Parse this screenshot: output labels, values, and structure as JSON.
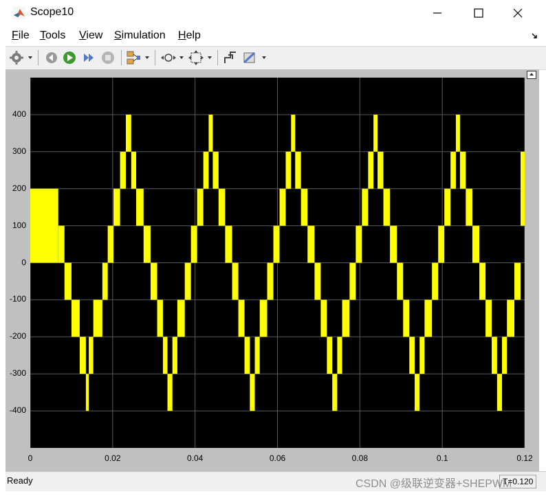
{
  "window": {
    "title": "Scope10"
  },
  "menu": {
    "items": [
      {
        "label": "File",
        "accel": "F",
        "rest": "ile"
      },
      {
        "label": "Tools",
        "accel": "T",
        "rest": "ools"
      },
      {
        "label": "View",
        "accel": "V",
        "rest": "iew"
      },
      {
        "label": "Simulation",
        "accel": "S",
        "rest": "imulation"
      },
      {
        "label": "Help",
        "accel": "H",
        "rest": "elp"
      }
    ]
  },
  "toolbar": {
    "icons": [
      "settings-gear-icon",
      "step-back-icon",
      "run-icon",
      "step-forward-icon",
      "stop-icon",
      "signal-select-icon",
      "zoom-icon",
      "autoscale-icon",
      "restore-layout-icon",
      "cursor-measure-icon"
    ]
  },
  "chart_data": {
    "type": "line",
    "title": "",
    "xlabel": "",
    "ylabel": "",
    "xlim": [
      0,
      0.12
    ],
    "ylim": [
      -500,
      500
    ],
    "xticks": [
      "0",
      "0.02",
      "0.04",
      "0.06",
      "0.08",
      "0.1",
      "0.12"
    ],
    "yticks": [
      "400",
      "300",
      "200",
      "100",
      "0",
      "-100",
      "-200",
      "-300",
      "-400"
    ],
    "grid": true,
    "background": "#000000",
    "series": [
      {
        "color": "#ffff00",
        "description_levels": "multilevel staircase PWM waveform, 9 levels from -400 to 400",
        "blocks": [
          {
            "x0": 0.0,
            "x1": 0.0068,
            "y0": 0,
            "y1": 200
          },
          {
            "x0": 0.0068,
            "x1": 0.0083,
            "y0": 0,
            "y1": 100
          },
          {
            "x0": 0.0083,
            "x1": 0.01,
            "y0": -100,
            "y1": 0
          },
          {
            "x0": 0.01,
            "x1": 0.012,
            "y0": -200,
            "y1": -100
          },
          {
            "x0": 0.012,
            "x1": 0.0135,
            "y0": -300,
            "y1": -200
          },
          {
            "x0": 0.0135,
            "x1": 0.0142,
            "y0": -400,
            "y1": -300
          },
          {
            "x0": 0.0142,
            "x1": 0.0153,
            "y0": -300,
            "y1": -200
          },
          {
            "x0": 0.0153,
            "x1": 0.0175,
            "y0": -200,
            "y1": -100
          },
          {
            "x0": 0.0175,
            "x1": 0.0188,
            "y0": -100,
            "y1": 0
          },
          {
            "x0": 0.0188,
            "x1": 0.0202,
            "y0": 0,
            "y1": 100
          },
          {
            "x0": 0.0202,
            "x1": 0.0218,
            "y0": 100,
            "y1": 200
          },
          {
            "x0": 0.0218,
            "x1": 0.0232,
            "y0": 200,
            "y1": 300
          },
          {
            "x0": 0.0232,
            "x1": 0.0245,
            "y0": 300,
            "y1": 400
          },
          {
            "x0": 0.0245,
            "x1": 0.0257,
            "y0": 200,
            "y1": 300
          },
          {
            "x0": 0.0257,
            "x1": 0.0275,
            "y0": 100,
            "y1": 200
          },
          {
            "x0": 0.0275,
            "x1": 0.0292,
            "y0": 0,
            "y1": 100
          },
          {
            "x0": 0.0292,
            "x1": 0.0308,
            "y0": -100,
            "y1": 0
          },
          {
            "x0": 0.0308,
            "x1": 0.0322,
            "y0": -200,
            "y1": -100
          },
          {
            "x0": 0.0322,
            "x1": 0.0333,
            "y0": -300,
            "y1": -200
          },
          {
            "x0": 0.0333,
            "x1": 0.0345,
            "y0": -400,
            "y1": -300
          },
          {
            "x0": 0.0345,
            "x1": 0.0357,
            "y0": -300,
            "y1": -200
          },
          {
            "x0": 0.0357,
            "x1": 0.0375,
            "y0": -200,
            "y1": -100
          },
          {
            "x0": 0.0375,
            "x1": 0.039,
            "y0": -100,
            "y1": 0
          },
          {
            "x0": 0.039,
            "x1": 0.0405,
            "y0": 0,
            "y1": 100
          },
          {
            "x0": 0.0405,
            "x1": 0.042,
            "y0": 100,
            "y1": 200
          },
          {
            "x0": 0.042,
            "x1": 0.0433,
            "y0": 200,
            "y1": 300
          },
          {
            "x0": 0.0433,
            "x1": 0.0443,
            "y0": 300,
            "y1": 400
          },
          {
            "x0": 0.0443,
            "x1": 0.0457,
            "y0": 200,
            "y1": 300
          },
          {
            "x0": 0.0457,
            "x1": 0.0473,
            "y0": 100,
            "y1": 200
          },
          {
            "x0": 0.0473,
            "x1": 0.049,
            "y0": 0,
            "y1": 100
          },
          {
            "x0": 0.049,
            "x1": 0.0505,
            "y0": -100,
            "y1": 0
          },
          {
            "x0": 0.0505,
            "x1": 0.052,
            "y0": -200,
            "y1": -100
          },
          {
            "x0": 0.052,
            "x1": 0.0533,
            "y0": -300,
            "y1": -200
          },
          {
            "x0": 0.0533,
            "x1": 0.0545,
            "y0": -400,
            "y1": -300
          },
          {
            "x0": 0.0545,
            "x1": 0.0557,
            "y0": -300,
            "y1": -200
          },
          {
            "x0": 0.0557,
            "x1": 0.0575,
            "y0": -200,
            "y1": -100
          },
          {
            "x0": 0.0575,
            "x1": 0.059,
            "y0": -100,
            "y1": 0
          },
          {
            "x0": 0.059,
            "x1": 0.0605,
            "y0": 0,
            "y1": 100
          },
          {
            "x0": 0.0605,
            "x1": 0.062,
            "y0": 100,
            "y1": 200
          },
          {
            "x0": 0.062,
            "x1": 0.0633,
            "y0": 200,
            "y1": 300
          },
          {
            "x0": 0.0633,
            "x1": 0.0643,
            "y0": 300,
            "y1": 400
          },
          {
            "x0": 0.0643,
            "x1": 0.0657,
            "y0": 200,
            "y1": 300
          },
          {
            "x0": 0.0657,
            "x1": 0.0673,
            "y0": 100,
            "y1": 200
          },
          {
            "x0": 0.0673,
            "x1": 0.069,
            "y0": 0,
            "y1": 100
          },
          {
            "x0": 0.069,
            "x1": 0.0705,
            "y0": -100,
            "y1": 0
          },
          {
            "x0": 0.0705,
            "x1": 0.072,
            "y0": -200,
            "y1": -100
          },
          {
            "x0": 0.072,
            "x1": 0.0733,
            "y0": -300,
            "y1": -200
          },
          {
            "x0": 0.0733,
            "x1": 0.0745,
            "y0": -400,
            "y1": -300
          },
          {
            "x0": 0.0745,
            "x1": 0.0757,
            "y0": -300,
            "y1": -200
          },
          {
            "x0": 0.0757,
            "x1": 0.0775,
            "y0": -200,
            "y1": -100
          },
          {
            "x0": 0.0775,
            "x1": 0.079,
            "y0": -100,
            "y1": 0
          },
          {
            "x0": 0.079,
            "x1": 0.0805,
            "y0": 0,
            "y1": 100
          },
          {
            "x0": 0.0805,
            "x1": 0.082,
            "y0": 100,
            "y1": 200
          },
          {
            "x0": 0.082,
            "x1": 0.0833,
            "y0": 200,
            "y1": 300
          },
          {
            "x0": 0.0833,
            "x1": 0.0843,
            "y0": 300,
            "y1": 400
          },
          {
            "x0": 0.0843,
            "x1": 0.0857,
            "y0": 200,
            "y1": 300
          },
          {
            "x0": 0.0857,
            "x1": 0.0873,
            "y0": 100,
            "y1": 200
          },
          {
            "x0": 0.0873,
            "x1": 0.089,
            "y0": 0,
            "y1": 100
          },
          {
            "x0": 0.089,
            "x1": 0.0905,
            "y0": -100,
            "y1": 0
          },
          {
            "x0": 0.0905,
            "x1": 0.092,
            "y0": -200,
            "y1": -100
          },
          {
            "x0": 0.092,
            "x1": 0.0933,
            "y0": -300,
            "y1": -200
          },
          {
            "x0": 0.0933,
            "x1": 0.0945,
            "y0": -400,
            "y1": -300
          },
          {
            "x0": 0.0945,
            "x1": 0.0957,
            "y0": -300,
            "y1": -200
          },
          {
            "x0": 0.0957,
            "x1": 0.0975,
            "y0": -200,
            "y1": -100
          },
          {
            "x0": 0.0975,
            "x1": 0.099,
            "y0": -100,
            "y1": 0
          },
          {
            "x0": 0.099,
            "x1": 0.1005,
            "y0": 0,
            "y1": 100
          },
          {
            "x0": 0.1005,
            "x1": 0.102,
            "y0": 100,
            "y1": 200
          },
          {
            "x0": 0.102,
            "x1": 0.1033,
            "y0": 200,
            "y1": 300
          },
          {
            "x0": 0.1033,
            "x1": 0.1043,
            "y0": 300,
            "y1": 400
          },
          {
            "x0": 0.1043,
            "x1": 0.1057,
            "y0": 200,
            "y1": 300
          },
          {
            "x0": 0.1057,
            "x1": 0.1073,
            "y0": 100,
            "y1": 200
          },
          {
            "x0": 0.1073,
            "x1": 0.109,
            "y0": 0,
            "y1": 100
          },
          {
            "x0": 0.109,
            "x1": 0.1105,
            "y0": -100,
            "y1": 0
          },
          {
            "x0": 0.1105,
            "x1": 0.112,
            "y0": -200,
            "y1": -100
          },
          {
            "x0": 0.112,
            "x1": 0.1133,
            "y0": -300,
            "y1": -200
          },
          {
            "x0": 0.1133,
            "x1": 0.1145,
            "y0": -400,
            "y1": -300
          },
          {
            "x0": 0.1145,
            "x1": 0.1157,
            "y0": -300,
            "y1": -200
          },
          {
            "x0": 0.1157,
            "x1": 0.1175,
            "y0": -200,
            "y1": -100
          },
          {
            "x0": 0.1175,
            "x1": 0.119,
            "y0": -100,
            "y1": 0
          },
          {
            "x0": 0.119,
            "x1": 0.12,
            "y0": 100,
            "y1": 300
          }
        ]
      }
    ]
  },
  "status": {
    "text": "Ready",
    "time": "T=0.120"
  },
  "watermark": "CSDN @级联逆变器+SHEPWM",
  "colors": {
    "plot_background": "#000000",
    "trace": "#ffff00",
    "frame": "#c0c0c0",
    "grid": "#5a5a5a"
  }
}
